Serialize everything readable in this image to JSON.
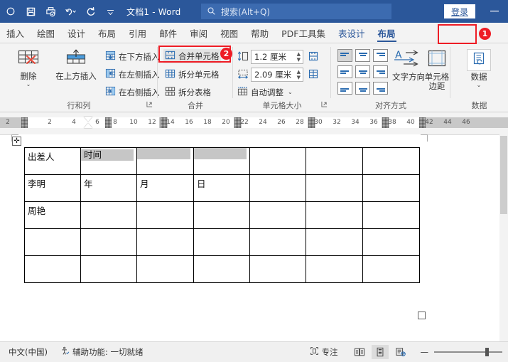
{
  "titlebar": {
    "quick_access": [
      {
        "name": "autosave-icon",
        "label": ""
      },
      {
        "name": "save-icon",
        "label": ""
      },
      {
        "name": "print-preview-icon",
        "label": ""
      },
      {
        "name": "undo-icon",
        "label": ""
      },
      {
        "name": "redo-icon",
        "label": ""
      },
      {
        "name": "customize-qat-icon",
        "label": ""
      }
    ],
    "document_title": "文档1 - Word",
    "search_placeholder": "搜索(Alt+Q)",
    "signin_label": "登录",
    "minimize_label": "—"
  },
  "tabs": [
    {
      "label": "插入",
      "state": "normal"
    },
    {
      "label": "绘图",
      "state": "normal"
    },
    {
      "label": "设计",
      "state": "normal"
    },
    {
      "label": "布局",
      "state": "normal"
    },
    {
      "label": "引用",
      "state": "normal"
    },
    {
      "label": "邮件",
      "state": "normal"
    },
    {
      "label": "审阅",
      "state": "normal"
    },
    {
      "label": "视图",
      "state": "normal"
    },
    {
      "label": "帮助",
      "state": "normal"
    },
    {
      "label": "PDF工具集",
      "state": "normal"
    },
    {
      "label": "表设计",
      "state": "contextual"
    },
    {
      "label": "布局",
      "state": "active"
    }
  ],
  "annotations": [
    {
      "badge": "1",
      "target": "布局 tab"
    },
    {
      "badge": "2",
      "target": "合并单元格 button"
    }
  ],
  "ribbon": {
    "groups": [
      {
        "name": "rows-columns",
        "label": "行和列",
        "buttons": [
          {
            "name": "delete-button",
            "label": "删除",
            "icon": "table-delete-icon",
            "has_dropdown": true
          },
          {
            "name": "insert-above-button",
            "label": "在上方插入",
            "icon": "insert-row-above-icon"
          },
          {
            "name": "insert-below-button",
            "label": "在下方插入",
            "icon": "insert-row-below-icon"
          },
          {
            "name": "insert-left-button",
            "label": "在左侧插入",
            "icon": "insert-column-left-icon"
          },
          {
            "name": "insert-right-button",
            "label": "在右侧插入",
            "icon": "insert-column-right-icon"
          }
        ],
        "has_dialog_launcher": true
      },
      {
        "name": "merge",
        "label": "合并",
        "buttons": [
          {
            "name": "merge-cells-button",
            "label": "合并单元格",
            "icon": "merge-cells-icon",
            "highlighted": true
          },
          {
            "name": "split-cells-button",
            "label": "拆分单元格",
            "icon": "split-cells-icon"
          },
          {
            "name": "split-table-button",
            "label": "拆分表格",
            "icon": "split-table-icon"
          }
        ],
        "has_dialog_launcher": false
      },
      {
        "name": "cell-size",
        "label": "单元格大小",
        "height_value": "1.2 厘米",
        "width_value": "2.09 厘米",
        "autofit_label": "自动调整",
        "distribute_rows_name": "distribute-rows-icon",
        "distribute_cols_name": "distribute-columns-icon",
        "has_dialog_launcher": true
      },
      {
        "name": "alignment",
        "label": "对齐方式",
        "align_grid_selected_index": 0,
        "text_direction_label": "文字方向",
        "cell_margins_label": "单元格\n边距"
      },
      {
        "name": "data",
        "label": "数据",
        "buttons": [
          {
            "name": "data-button",
            "label": "数据",
            "icon": "data-repeat-icon",
            "has_dropdown": true
          }
        ]
      }
    ]
  },
  "ruler": {
    "left_gutter_number": "2",
    "numbers": [
      "2",
      "4",
      "6",
      "8",
      "10",
      "12",
      "14",
      "16",
      "18",
      "20",
      "22",
      "24",
      "26",
      "28",
      "30",
      "32",
      "34",
      "36",
      "38",
      "40",
      "42",
      "44",
      "46"
    ]
  },
  "document": {
    "table": {
      "columns": 7,
      "rows": 5,
      "cells": [
        [
          "出差人",
          "时间",
          "",
          "",
          "",
          "",
          ""
        ],
        [
          "李明",
          "年",
          "月",
          "日",
          "",
          "",
          ""
        ],
        [
          "周艳",
          "",
          "",
          "",
          "",
          "",
          ""
        ],
        [
          "",
          "",
          "",
          "",
          "",
          "",
          ""
        ],
        [
          "",
          "",
          "",
          "",
          "",
          "",
          ""
        ]
      ],
      "selected_cells": [
        [
          0,
          1
        ],
        [
          0,
          2
        ],
        [
          0,
          3
        ]
      ]
    }
  },
  "statusbar": {
    "language": "中文(中国)",
    "accessibility": "辅助功能: 一切就绪",
    "focus_label": "专注",
    "views": [
      {
        "name": "read-mode-view-button",
        "selected": false
      },
      {
        "name": "print-layout-view-button",
        "selected": true
      },
      {
        "name": "web-layout-view-button",
        "selected": false
      }
    ],
    "zoom_out_label": "—",
    "zoom_level": ""
  },
  "colors": {
    "accent": "#2b579a",
    "annotation": "#ee1c25",
    "ribbon_bg": "#f3f3f3",
    "selection_gray": "#c6c6c6"
  }
}
